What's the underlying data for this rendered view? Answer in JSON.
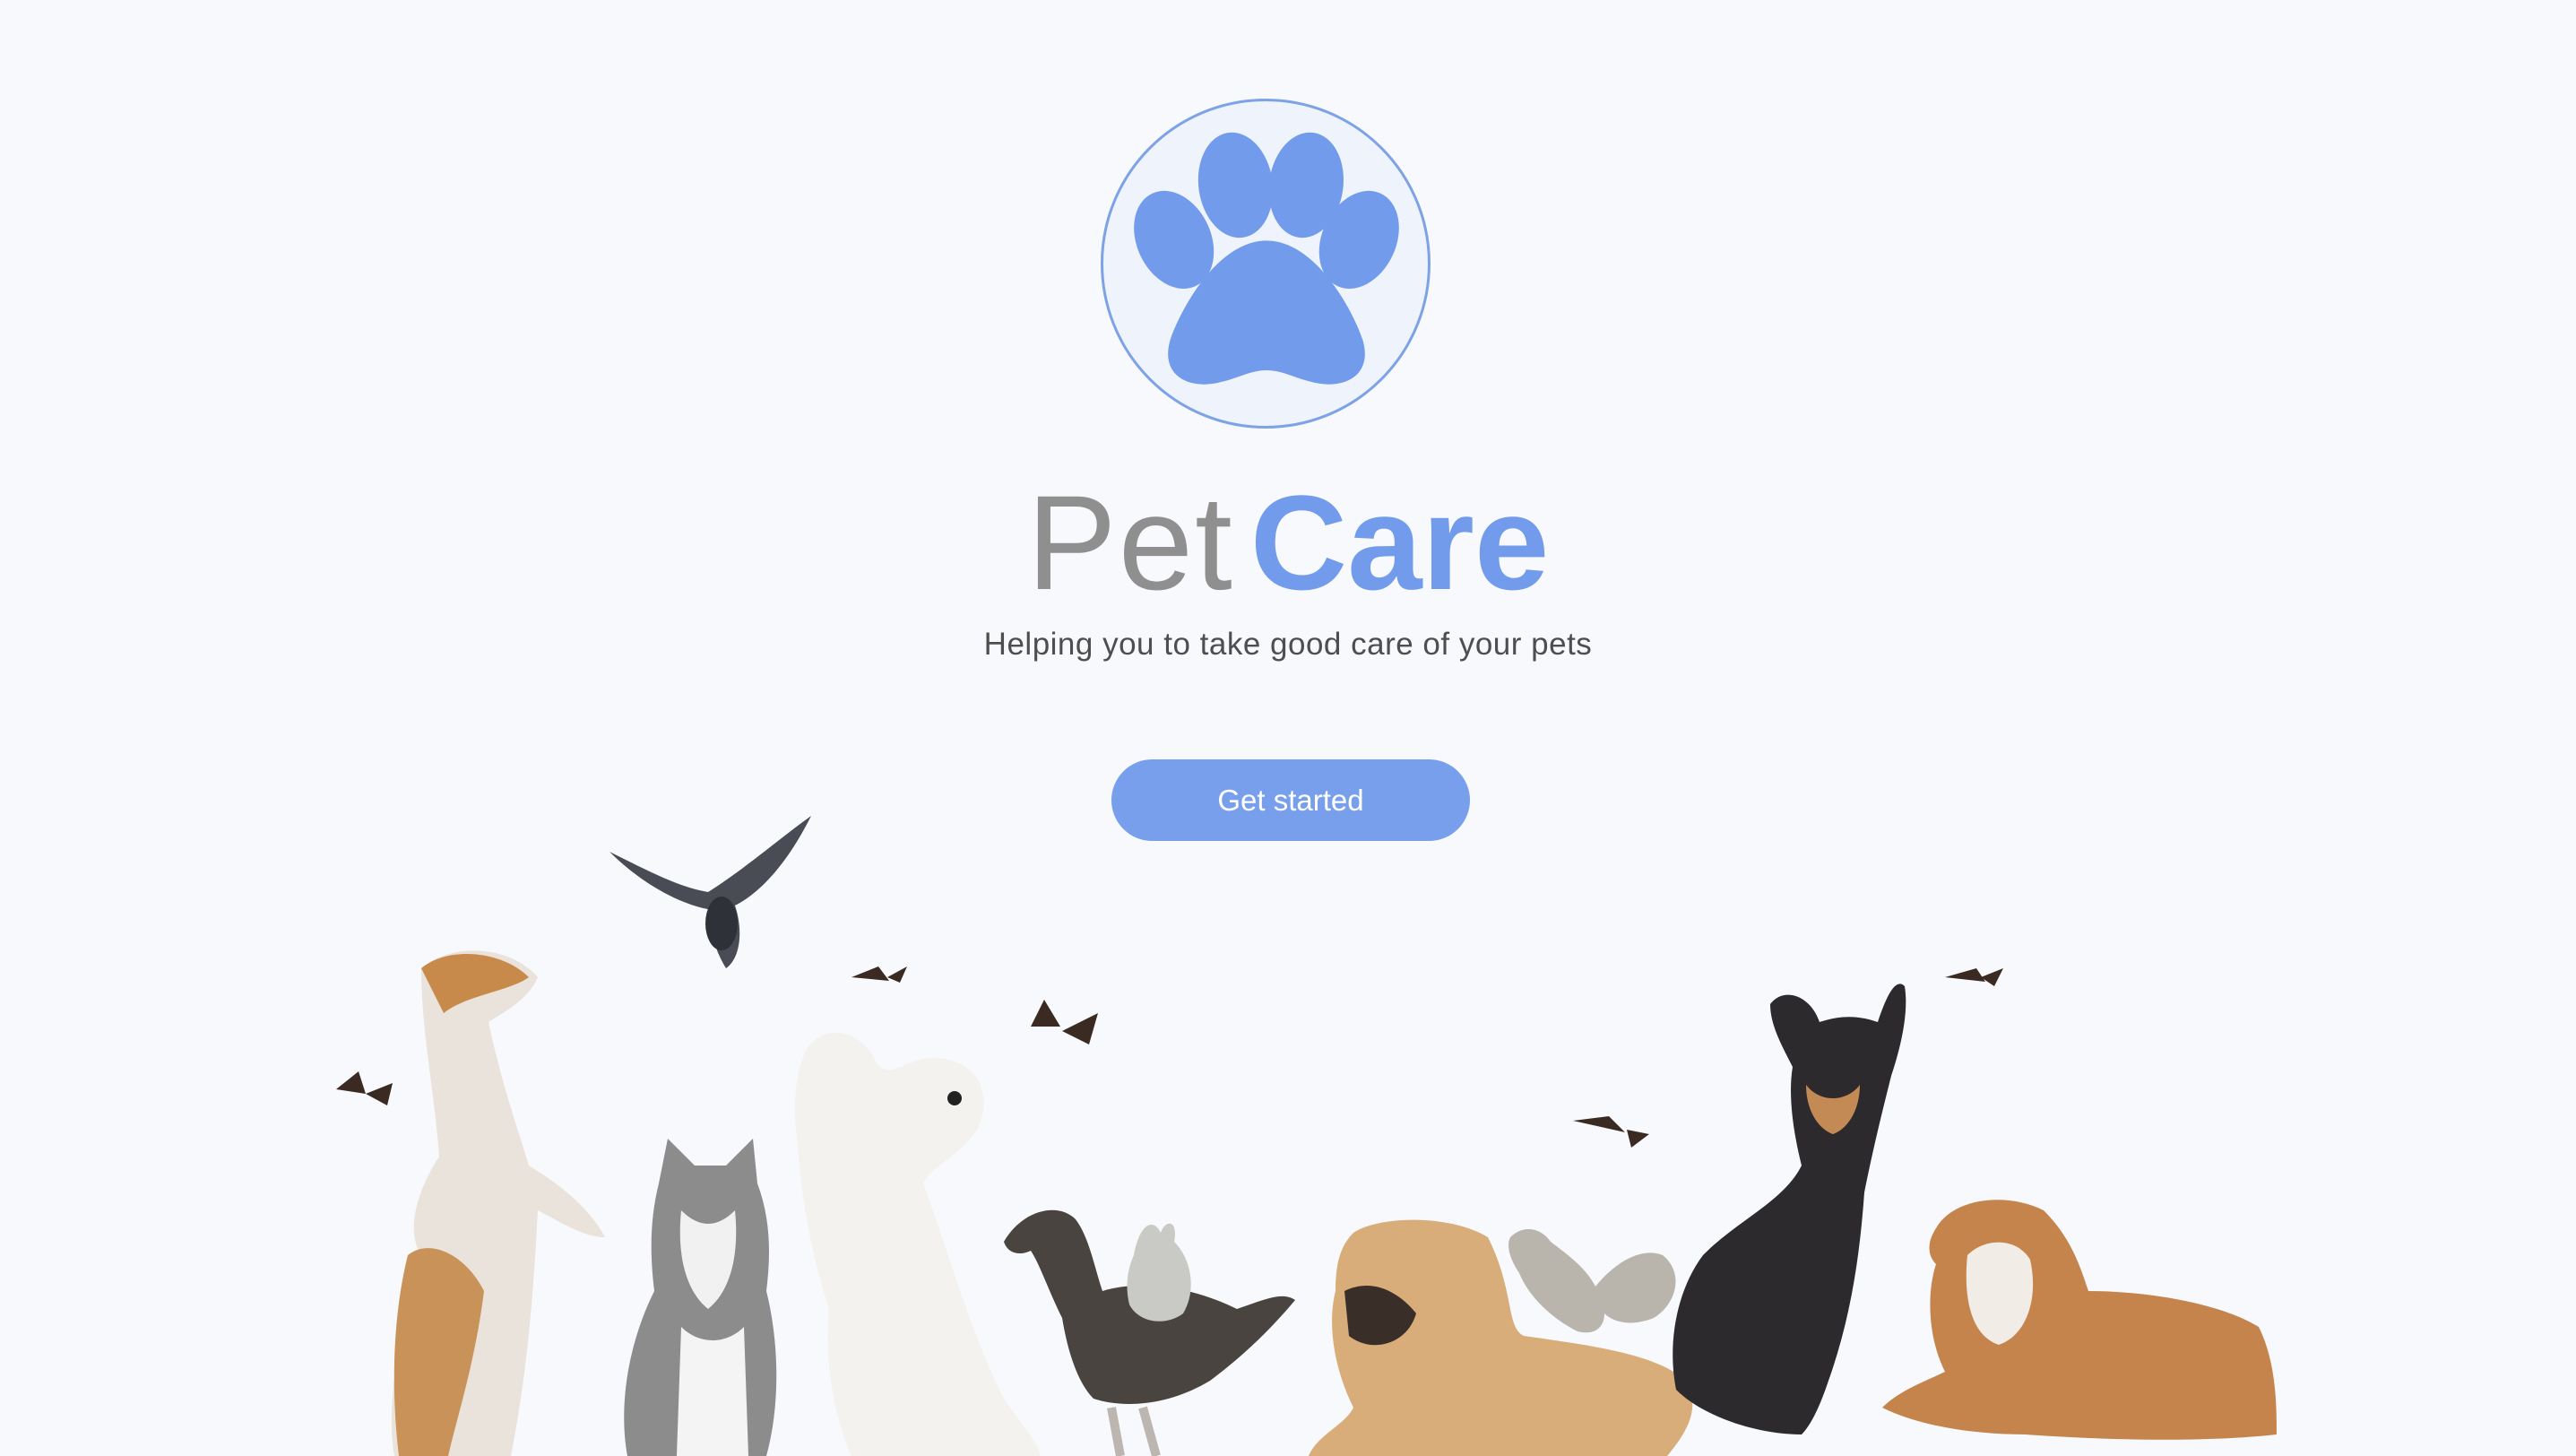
{
  "brand": {
    "name_light": "Pet",
    "name_bold": "Care",
    "tagline": "Helping you to take good care of your pets",
    "logo_icon": "paw-icon",
    "colors": {
      "accent": "#729ceb",
      "muted_text": "#8f8f8f",
      "background": "#f8f9fc"
    }
  },
  "cta": {
    "label": "Get started"
  },
  "illustration": {
    "animals": [
      "dog-standing",
      "cat",
      "west-highland-terrier",
      "duck",
      "rabbit",
      "pug",
      "squirrel",
      "chihuahua",
      "beagle",
      "pigeon",
      "butterflies"
    ]
  }
}
